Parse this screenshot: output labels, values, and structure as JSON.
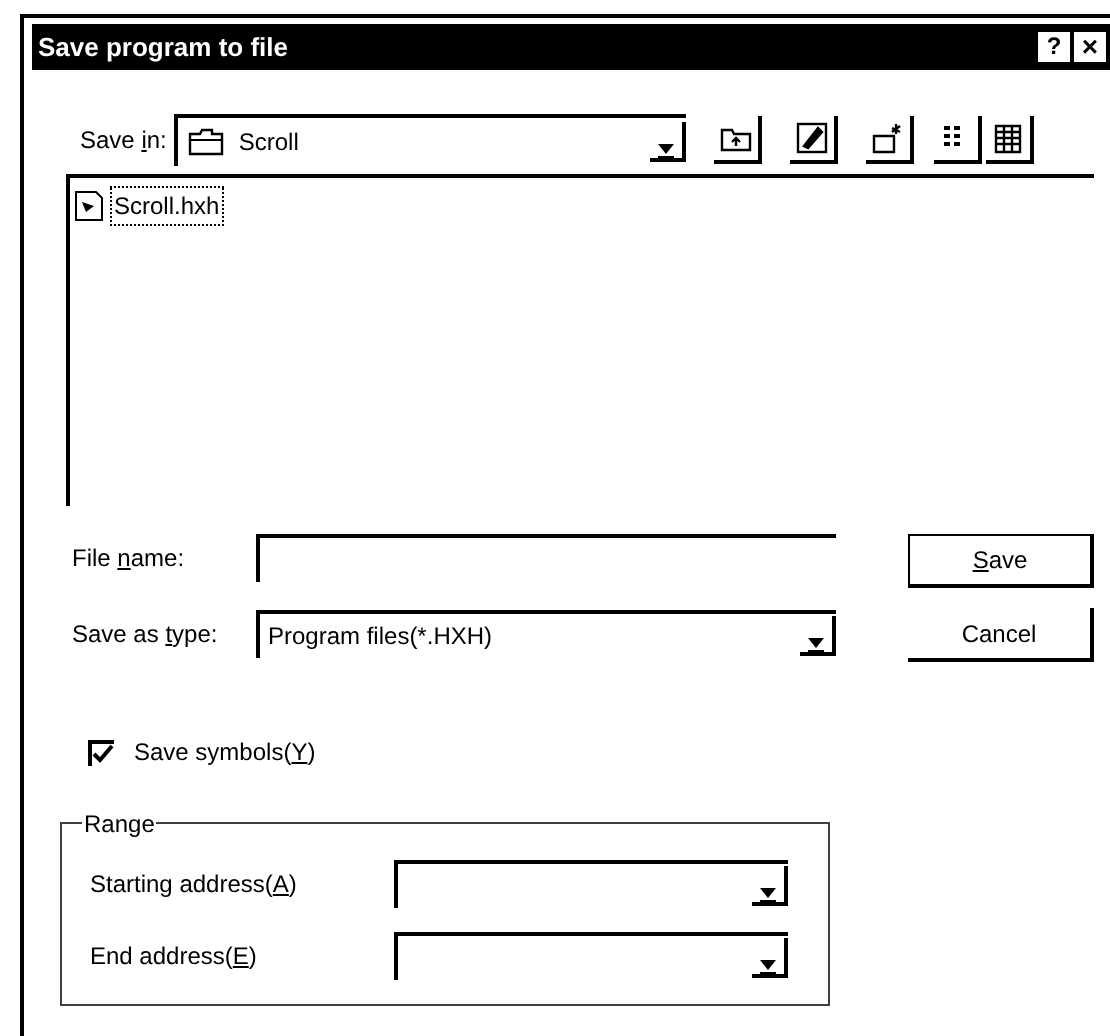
{
  "window": {
    "title": "Save program to file",
    "help": "?",
    "close": "×"
  },
  "save_in": {
    "label": [
      {
        "t": "Save ",
        "underline": false
      },
      {
        "t": "i",
        "underline": true
      },
      {
        "t": "n:",
        "underline": false
      }
    ],
    "value": "Scroll"
  },
  "files": [
    {
      "name": "Scroll.hxh",
      "selected": true
    }
  ],
  "file_name": {
    "label": [
      {
        "t": "File ",
        "underline": false
      },
      {
        "t": "n",
        "underline": true
      },
      {
        "t": "ame:",
        "underline": false
      }
    ]
  },
  "save_as_type": {
    "label": [
      {
        "t": "Save as ",
        "underline": false
      },
      {
        "t": "t",
        "underline": true
      },
      {
        "t": "ype:",
        "underline": false
      }
    ],
    "value": "Program files(*.HXH)"
  },
  "buttons": [
    {
      "label": [
        {
          "t": "S",
          "underline": true
        },
        {
          "t": "ave",
          "underline": false
        }
      ],
      "default": true
    },
    {
      "label": [
        {
          "t": "Cancel",
          "underline": false
        }
      ],
      "default": false
    }
  ],
  "save_symbols": {
    "label": [
      {
        "t": "Save symbols(",
        "underline": false
      },
      {
        "t": "Y",
        "underline": true
      },
      {
        "t": ")",
        "underline": false
      }
    ],
    "checked": true
  },
  "range": {
    "title": "Range",
    "fields": [
      {
        "label": [
          {
            "t": "Starting address(",
            "underline": false
          },
          {
            "t": "A",
            "underline": true
          },
          {
            "t": ")",
            "underline": false
          }
        ]
      },
      {
        "label": [
          {
            "t": "End address(",
            "underline": false
          },
          {
            "t": "E",
            "underline": true
          },
          {
            "t": ")",
            "underline": false
          }
        ]
      }
    ]
  }
}
